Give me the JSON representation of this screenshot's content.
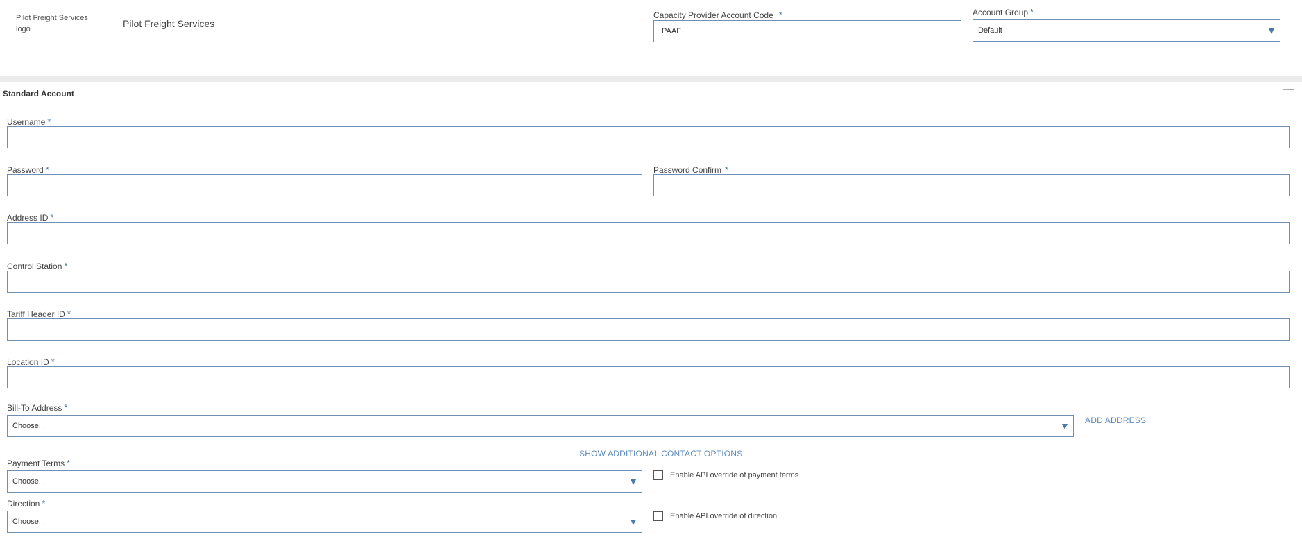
{
  "header": {
    "logo_alt": "Pilot Freight Services logo",
    "company_name": "Pilot Freight Services",
    "account_code_label": "Capacity Provider Account Code",
    "account_code_value": "PAAF",
    "account_group_label": "Account Group",
    "account_group_value": "Default"
  },
  "section": {
    "title": "Standard Account",
    "collapse_glyph": "—"
  },
  "form": {
    "required_mark": "*",
    "username_label": "Username",
    "password_label": "Password",
    "password_confirm_label": "Password Confirm",
    "address_id_label": "Address ID",
    "control_station_label": "Control Station",
    "tariff_header_label": "Tariff Header ID",
    "location_id_label": "Location ID",
    "bill_to_label": "Bill-To Address",
    "bill_to_value": "Choose...",
    "add_address": "ADD ADDRESS",
    "show_contact_options": "SHOW ADDITIONAL CONTACT OPTIONS",
    "payment_terms_label": "Payment Terms",
    "payment_terms_value": "Choose...",
    "payment_override_label": "Enable API override of payment terms",
    "direction_label": "Direction",
    "direction_value": "Choose...",
    "direction_override_label": "Enable API override of direction"
  },
  "colors": {
    "accent": "#4a78a8",
    "input_border": "#6f8fb3",
    "link": "#5b8ab8",
    "divider_band": "#ebebeb"
  }
}
